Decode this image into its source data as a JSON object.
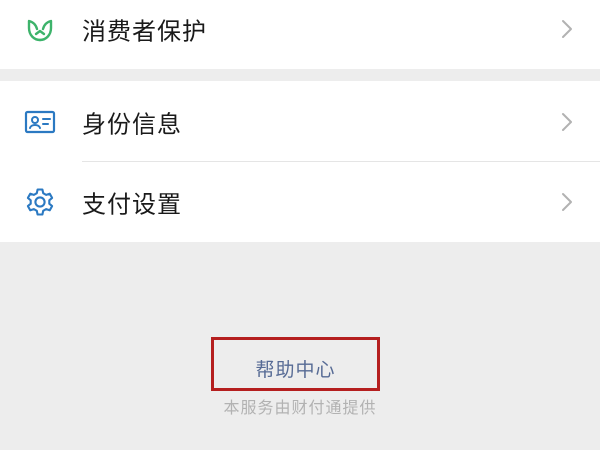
{
  "items": [
    {
      "label": "消费者保护",
      "icon": "consumer-protection-icon"
    },
    {
      "label": "身份信息",
      "icon": "id-card-icon"
    },
    {
      "label": "支付设置",
      "icon": "gear-icon"
    }
  ],
  "help_link": "帮助中心",
  "footer_note": "本服务由财付通提供",
  "colors": {
    "icon_green": "#3db36b",
    "icon_blue": "#2b79c2",
    "link_blue": "#576b95",
    "highlight_red": "#b51f1f",
    "chevron_gray": "#b2b2b2"
  }
}
